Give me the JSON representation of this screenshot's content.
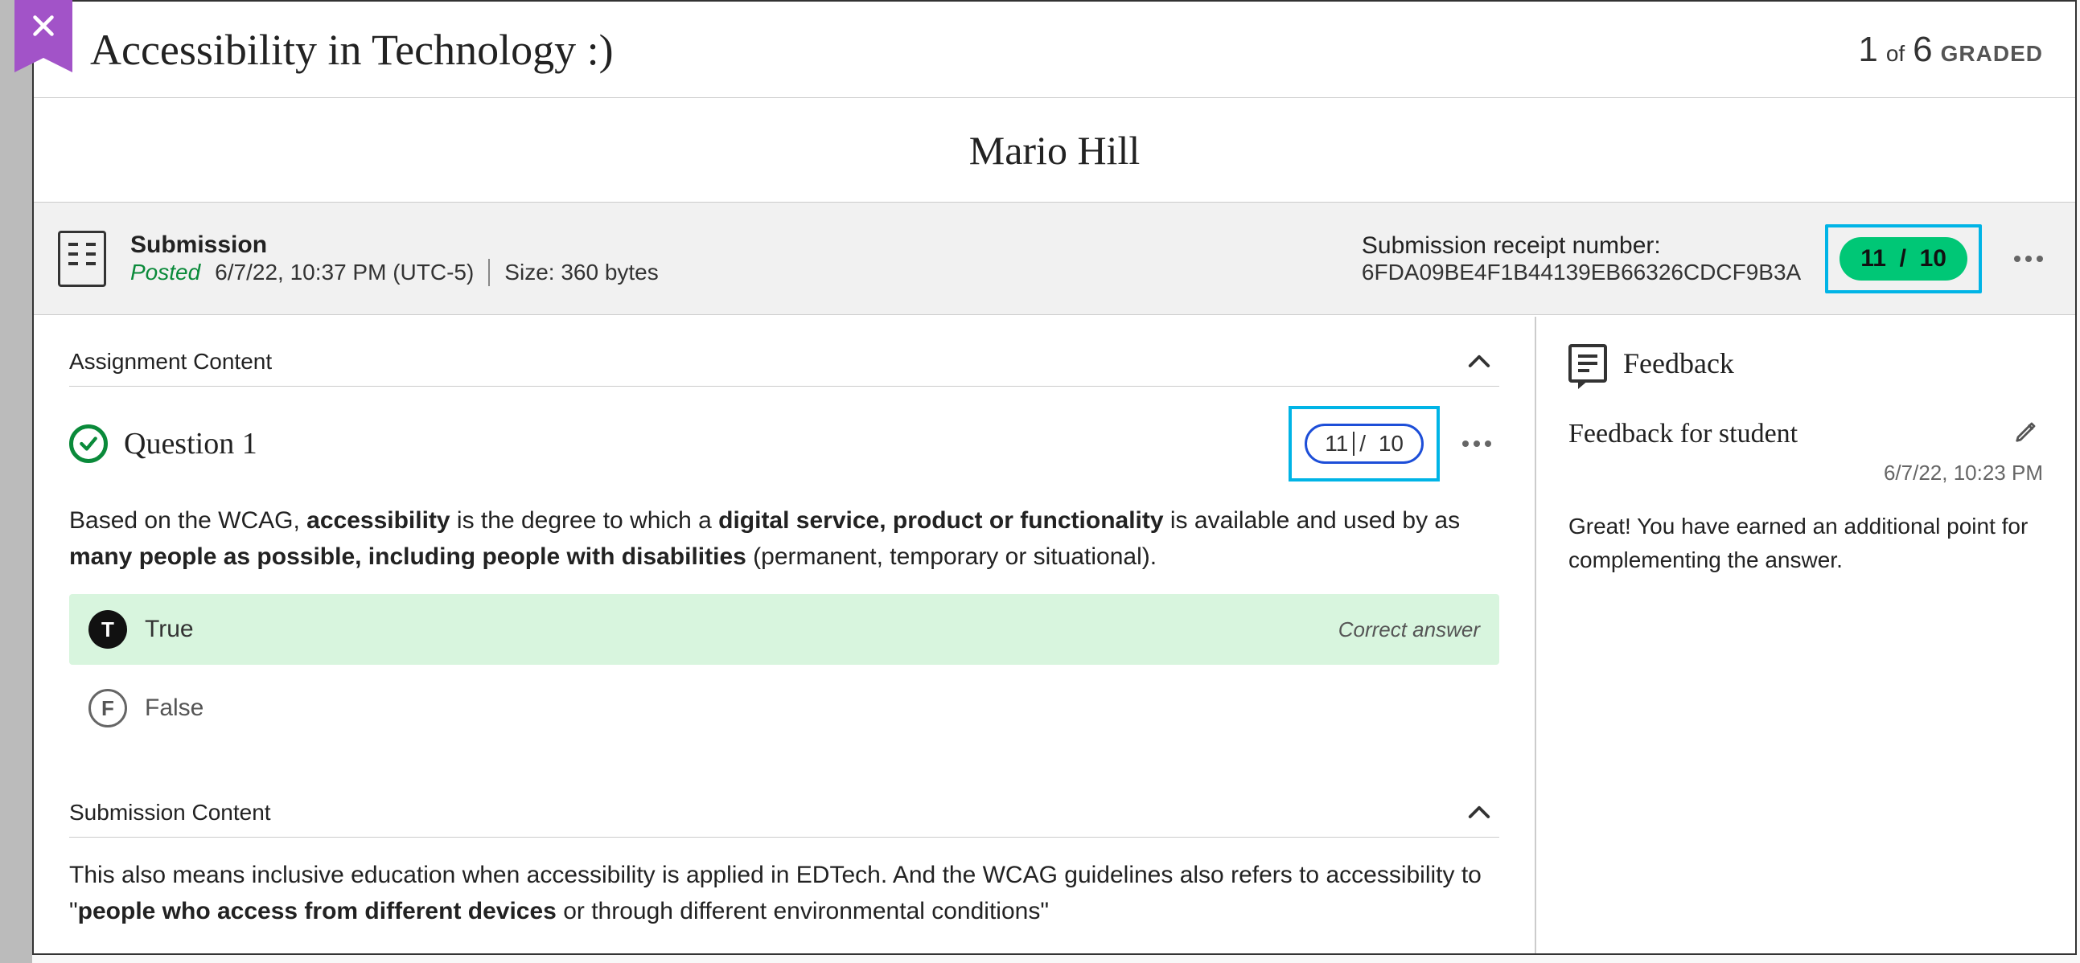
{
  "header": {
    "title": "Accessibility in Technology :)",
    "current": "1",
    "of_label": "of",
    "total": "6",
    "status": "GRADED"
  },
  "student": {
    "name": "Mario Hill"
  },
  "submission": {
    "label": "Submission",
    "posted_label": "Posted",
    "posted_time": "6/7/22, 10:37 PM (UTC-5)",
    "size_label": "Size: 360 bytes",
    "receipt_label": "Submission receipt number:",
    "receipt_value": "6FDA09BE4F1B44139EB66326CDCF9B3A",
    "score_earned": "11",
    "score_sep": "/",
    "score_total": "10"
  },
  "content": {
    "assignment_heading": "Assignment Content",
    "question_title": "Question 1",
    "question_score_earned": "11",
    "question_score_total": "10",
    "question_score_sep": "/",
    "question_text_prefix": "Based on the WCAG, ",
    "question_bold1": "accessibility",
    "question_mid1": " is the degree to which a ",
    "question_bold2": "digital service, product or functionality",
    "question_mid2": " is available and used by as ",
    "question_bold3": "many people as possible, including people with disabilities",
    "question_suffix": " (permanent, temporary or situational).",
    "answer_true_badge": "T",
    "answer_true_label": "True",
    "correct_answer_tag": "Correct answer",
    "answer_false_badge": "F",
    "answer_false_label": "False",
    "submission_heading": "Submission Content",
    "submission_text_prefix": "This also means inclusive education when accessibility is applied in EDTech. And the WCAG guidelines also refers to accessibility to \"",
    "submission_bold": "people who access from different devices",
    "submission_suffix": " or through different environmental conditions\""
  },
  "feedback": {
    "panel_heading": "Feedback",
    "sub_heading": "Feedback for student",
    "timestamp": "6/7/22, 10:23 PM",
    "body": "Great! You have earned an additional point for complementing the answer."
  }
}
